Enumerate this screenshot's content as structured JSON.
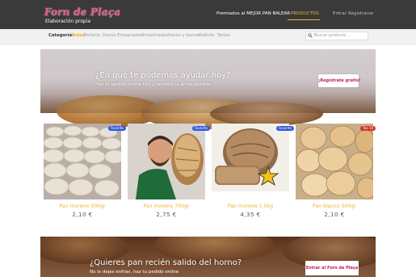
{
  "header": {
    "logo_text": "Forn de Plaça",
    "tagline": "Elaboración propia",
    "nav": [
      {
        "label": "Premiados al MEJOR PAN BALEAR"
      },
      {
        "label": "PRODUCTOS"
      },
      {
        "label": "Entrar"
      },
      {
        "label": "Registrarse"
      }
    ]
  },
  "categories": {
    "label": "Categoría:",
    "items": [
      "Todas",
      "Bollería",
      "Doces",
      "Empanadas",
      "Ensaimadas",
      "Panes y barras",
      "Robiolo",
      "Tartas"
    ],
    "search_placeholder": "Buscar producto ..."
  },
  "hero": {
    "title": "¿En qué te podemos ayudar hoy?",
    "subtitle": "Haz tu pedido online hoy y recíbelo lo antes posible",
    "button": "¡Regístrate gratis!"
  },
  "products": [
    {
      "name": "Pan moreno 500gr",
      "price": "2,10 €",
      "badge": "Favorito"
    },
    {
      "name": "Pan moreno 700gr",
      "price": "2,75 €",
      "badge": "Favorito"
    },
    {
      "name": "Pan moreno 1.5kg",
      "price": "4,35 €",
      "badge": "Favorito"
    },
    {
      "name": "Pan blanco 500gr",
      "price": "2,10 €",
      "badge": "Top 10"
    }
  ],
  "banner": {
    "title": "¿Quieres pan recién salido del horno?",
    "subtitle": "No lo dejes enfriar, haz tu pedido online",
    "button": "Entrar al Forn de Plaça"
  },
  "colors": {
    "accent": "#e9b52b",
    "brand_pink": "#c2185b",
    "topbar": "#3a3a3a",
    "badge_favorite": "#3558d6",
    "badge_top": "#d2332b"
  }
}
